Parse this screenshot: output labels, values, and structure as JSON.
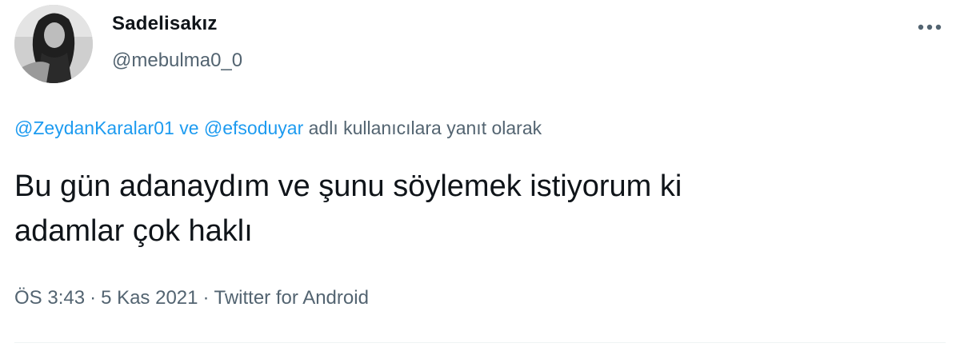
{
  "author": {
    "display_name": "Sadelisakız",
    "handle": "@mebulma0_0",
    "avatar_icon": "user-avatar-photo"
  },
  "more_icon": "more-horizontal-icon",
  "reply_context": {
    "mention_1": "@ZeydanKaralar01",
    "joiner": "ve",
    "mention_2": "@efsoduyar",
    "suffix": "adlı kullanıcılara yanıt olarak"
  },
  "tweet": {
    "line_1": "Bu gün adanaydım ve şunu söylemek istiyorum ki",
    "line_2": "adamlar çok haklı"
  },
  "meta": {
    "time": "ÖS 3:43",
    "separator": "·",
    "date": "5 Kas 2021",
    "source": "Twitter for Android"
  },
  "colors": {
    "text": "#0f1419",
    "secondary": "#536471",
    "link": "#1d9bf0",
    "divider": "#eff3f4"
  }
}
